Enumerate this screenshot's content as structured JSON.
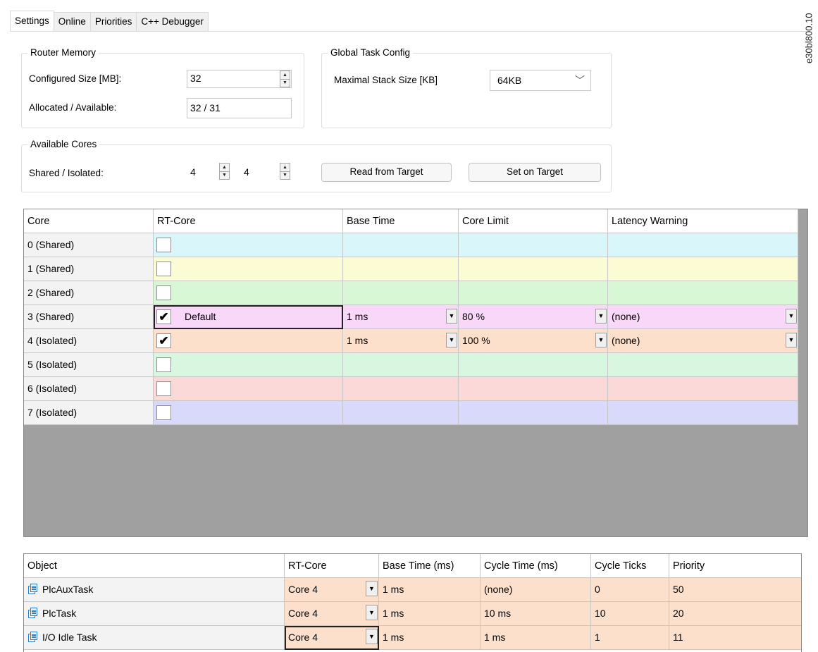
{
  "side_caption": "e30bl800.10",
  "tabs": [
    {
      "label": "Settings",
      "active": true
    },
    {
      "label": "Online",
      "active": false
    },
    {
      "label": "Priorities",
      "active": false
    },
    {
      "label": "C++ Debugger",
      "active": false
    }
  ],
  "router_memory": {
    "title": "Router Memory",
    "configured_label": "Configured Size [MB]:",
    "configured_value": "32",
    "allocated_label": "Allocated / Available:",
    "allocated_value": "32 / 31"
  },
  "global_task_config": {
    "title": "Global Task Config",
    "stack_label": "Maximal Stack Size [KB]",
    "stack_value": "64KB"
  },
  "available_cores": {
    "title": "Available Cores",
    "label": "Shared / Isolated:",
    "shared_value": "4",
    "isolated_value": "4",
    "read_button": "Read from Target",
    "set_button": "Set on Target"
  },
  "core_grid": {
    "columns": [
      "Core",
      "RT-Core",
      "Base Time",
      "Core Limit",
      "Latency Warning"
    ],
    "rows": [
      {
        "core": "0 (Shared)",
        "checked": false,
        "rt_label": "",
        "base_time": "",
        "core_limit": "",
        "latency": "",
        "color": "#d9f7fb"
      },
      {
        "core": "1 (Shared)",
        "checked": false,
        "rt_label": "",
        "base_time": "",
        "core_limit": "",
        "latency": "",
        "color": "#fbfbd4"
      },
      {
        "core": "2 (Shared)",
        "checked": false,
        "rt_label": "",
        "base_time": "",
        "core_limit": "",
        "latency": "",
        "color": "#d7f7d5"
      },
      {
        "core": "3 (Shared)",
        "checked": true,
        "rt_label": "Default",
        "base_time": "1 ms",
        "core_limit": "80 %",
        "latency": "(none)",
        "color": "#f9d7f8"
      },
      {
        "core": "4 (Isolated)",
        "checked": true,
        "rt_label": "",
        "base_time": "1 ms",
        "core_limit": "100 %",
        "latency": "(none)",
        "color": "#fde0cc"
      },
      {
        "core": "5 (Isolated)",
        "checked": false,
        "rt_label": "",
        "base_time": "",
        "core_limit": "",
        "latency": "",
        "color": "#d7f7e0"
      },
      {
        "core": "6 (Isolated)",
        "checked": false,
        "rt_label": "",
        "base_time": "",
        "core_limit": "",
        "latency": "",
        "color": "#fbd9d9"
      },
      {
        "core": "7 (Isolated)",
        "checked": false,
        "rt_label": "",
        "base_time": "",
        "core_limit": "",
        "latency": "",
        "color": "#d9d9fb"
      }
    ]
  },
  "task_grid": {
    "columns": [
      "Object",
      "RT-Core",
      "Base Time (ms)",
      "Cycle Time (ms)",
      "Cycle Ticks",
      "Priority"
    ],
    "rows": [
      {
        "object": "PlcAuxTask",
        "rt_core": "Core 4",
        "base_time": "1 ms",
        "cycle_time": "(none)",
        "cycle_ticks": "0",
        "priority": "50"
      },
      {
        "object": "PlcTask",
        "rt_core": "Core 4",
        "base_time": "1 ms",
        "cycle_time": "10 ms",
        "cycle_ticks": "10",
        "priority": "20"
      },
      {
        "object": "I/O Idle Task",
        "rt_core": "Core 4",
        "base_time": "1 ms",
        "cycle_time": "1 ms",
        "cycle_ticks": "1",
        "priority": "11"
      }
    ],
    "row_color": "#fde0cc"
  },
  "icons": {
    "spin_up": "▲",
    "spin_down": "▼",
    "chevron": "﹀",
    "dropdown": "▼",
    "check": "✔"
  }
}
